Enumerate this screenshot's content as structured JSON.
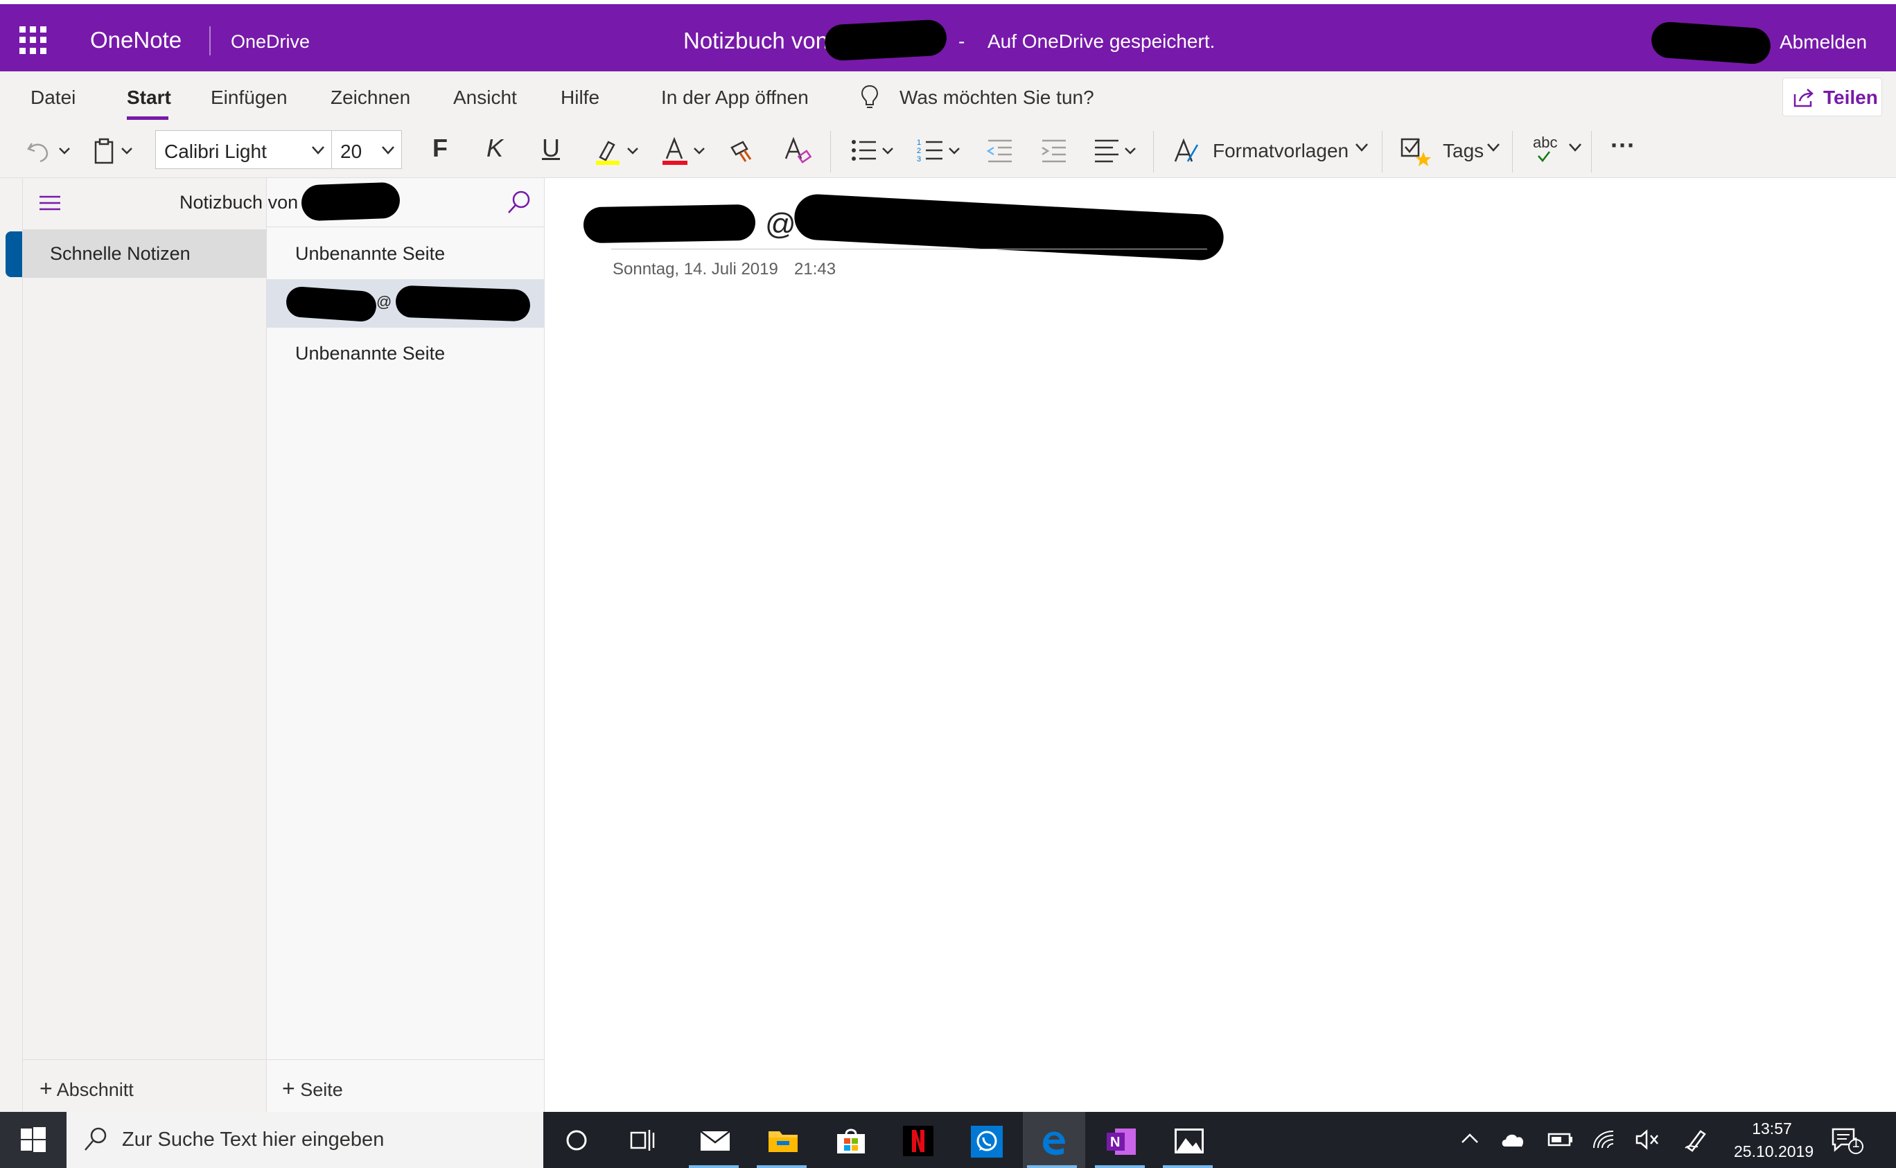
{
  "header": {
    "app_name": "OneNote",
    "service": "OneDrive",
    "notebook_title": "Notizbuch von",
    "title_separator": "-",
    "save_status": "Auf OneDrive gespeichert.",
    "signout": "Abmelden",
    "bg_color": "#7719aa"
  },
  "menu": {
    "tabs": [
      "Datei",
      "Start",
      "Einfügen",
      "Zeichnen",
      "Ansicht",
      "Hilfe",
      "In der App öffnen"
    ],
    "active_tab": "Start",
    "tell_me": "Was möchten Sie tun?",
    "share": "Teilen"
  },
  "toolbar": {
    "font_name": "Calibri Light",
    "font_size": "20",
    "bold": "F",
    "italic": "K",
    "underline": "U",
    "styles": "Formatvorlagen",
    "tags": "Tags",
    "spelling": "abc",
    "more": "···"
  },
  "navigation": {
    "notebook_label": "Notizbuch von",
    "sections": [
      {
        "label": "Schnelle Notizen",
        "selected": true
      }
    ],
    "add_section": "Abschnitt",
    "pages": [
      {
        "label": "Unbenannte Seite",
        "selected": false
      },
      {
        "label": "",
        "selected": true
      },
      {
        "label": "Unbenannte Seite",
        "selected": false
      }
    ],
    "add_page": "Seite",
    "section_color": "#005a9e"
  },
  "page": {
    "title_at": "@",
    "selected_page_at": "@",
    "date": "Sonntag, 14. Juli 2019",
    "time": "21:43"
  },
  "taskbar": {
    "search_placeholder": "Zur Suche Text hier eingeben",
    "apps": [
      "cortana-icon",
      "task-view-icon",
      "mail-icon",
      "file-explorer-icon",
      "store-icon",
      "netflix-icon",
      "whatsapp-icon",
      "edge-icon",
      "onenote-icon",
      "photos-icon"
    ],
    "time": "13:57",
    "date": "25.10.2019",
    "notification_count": "1"
  }
}
